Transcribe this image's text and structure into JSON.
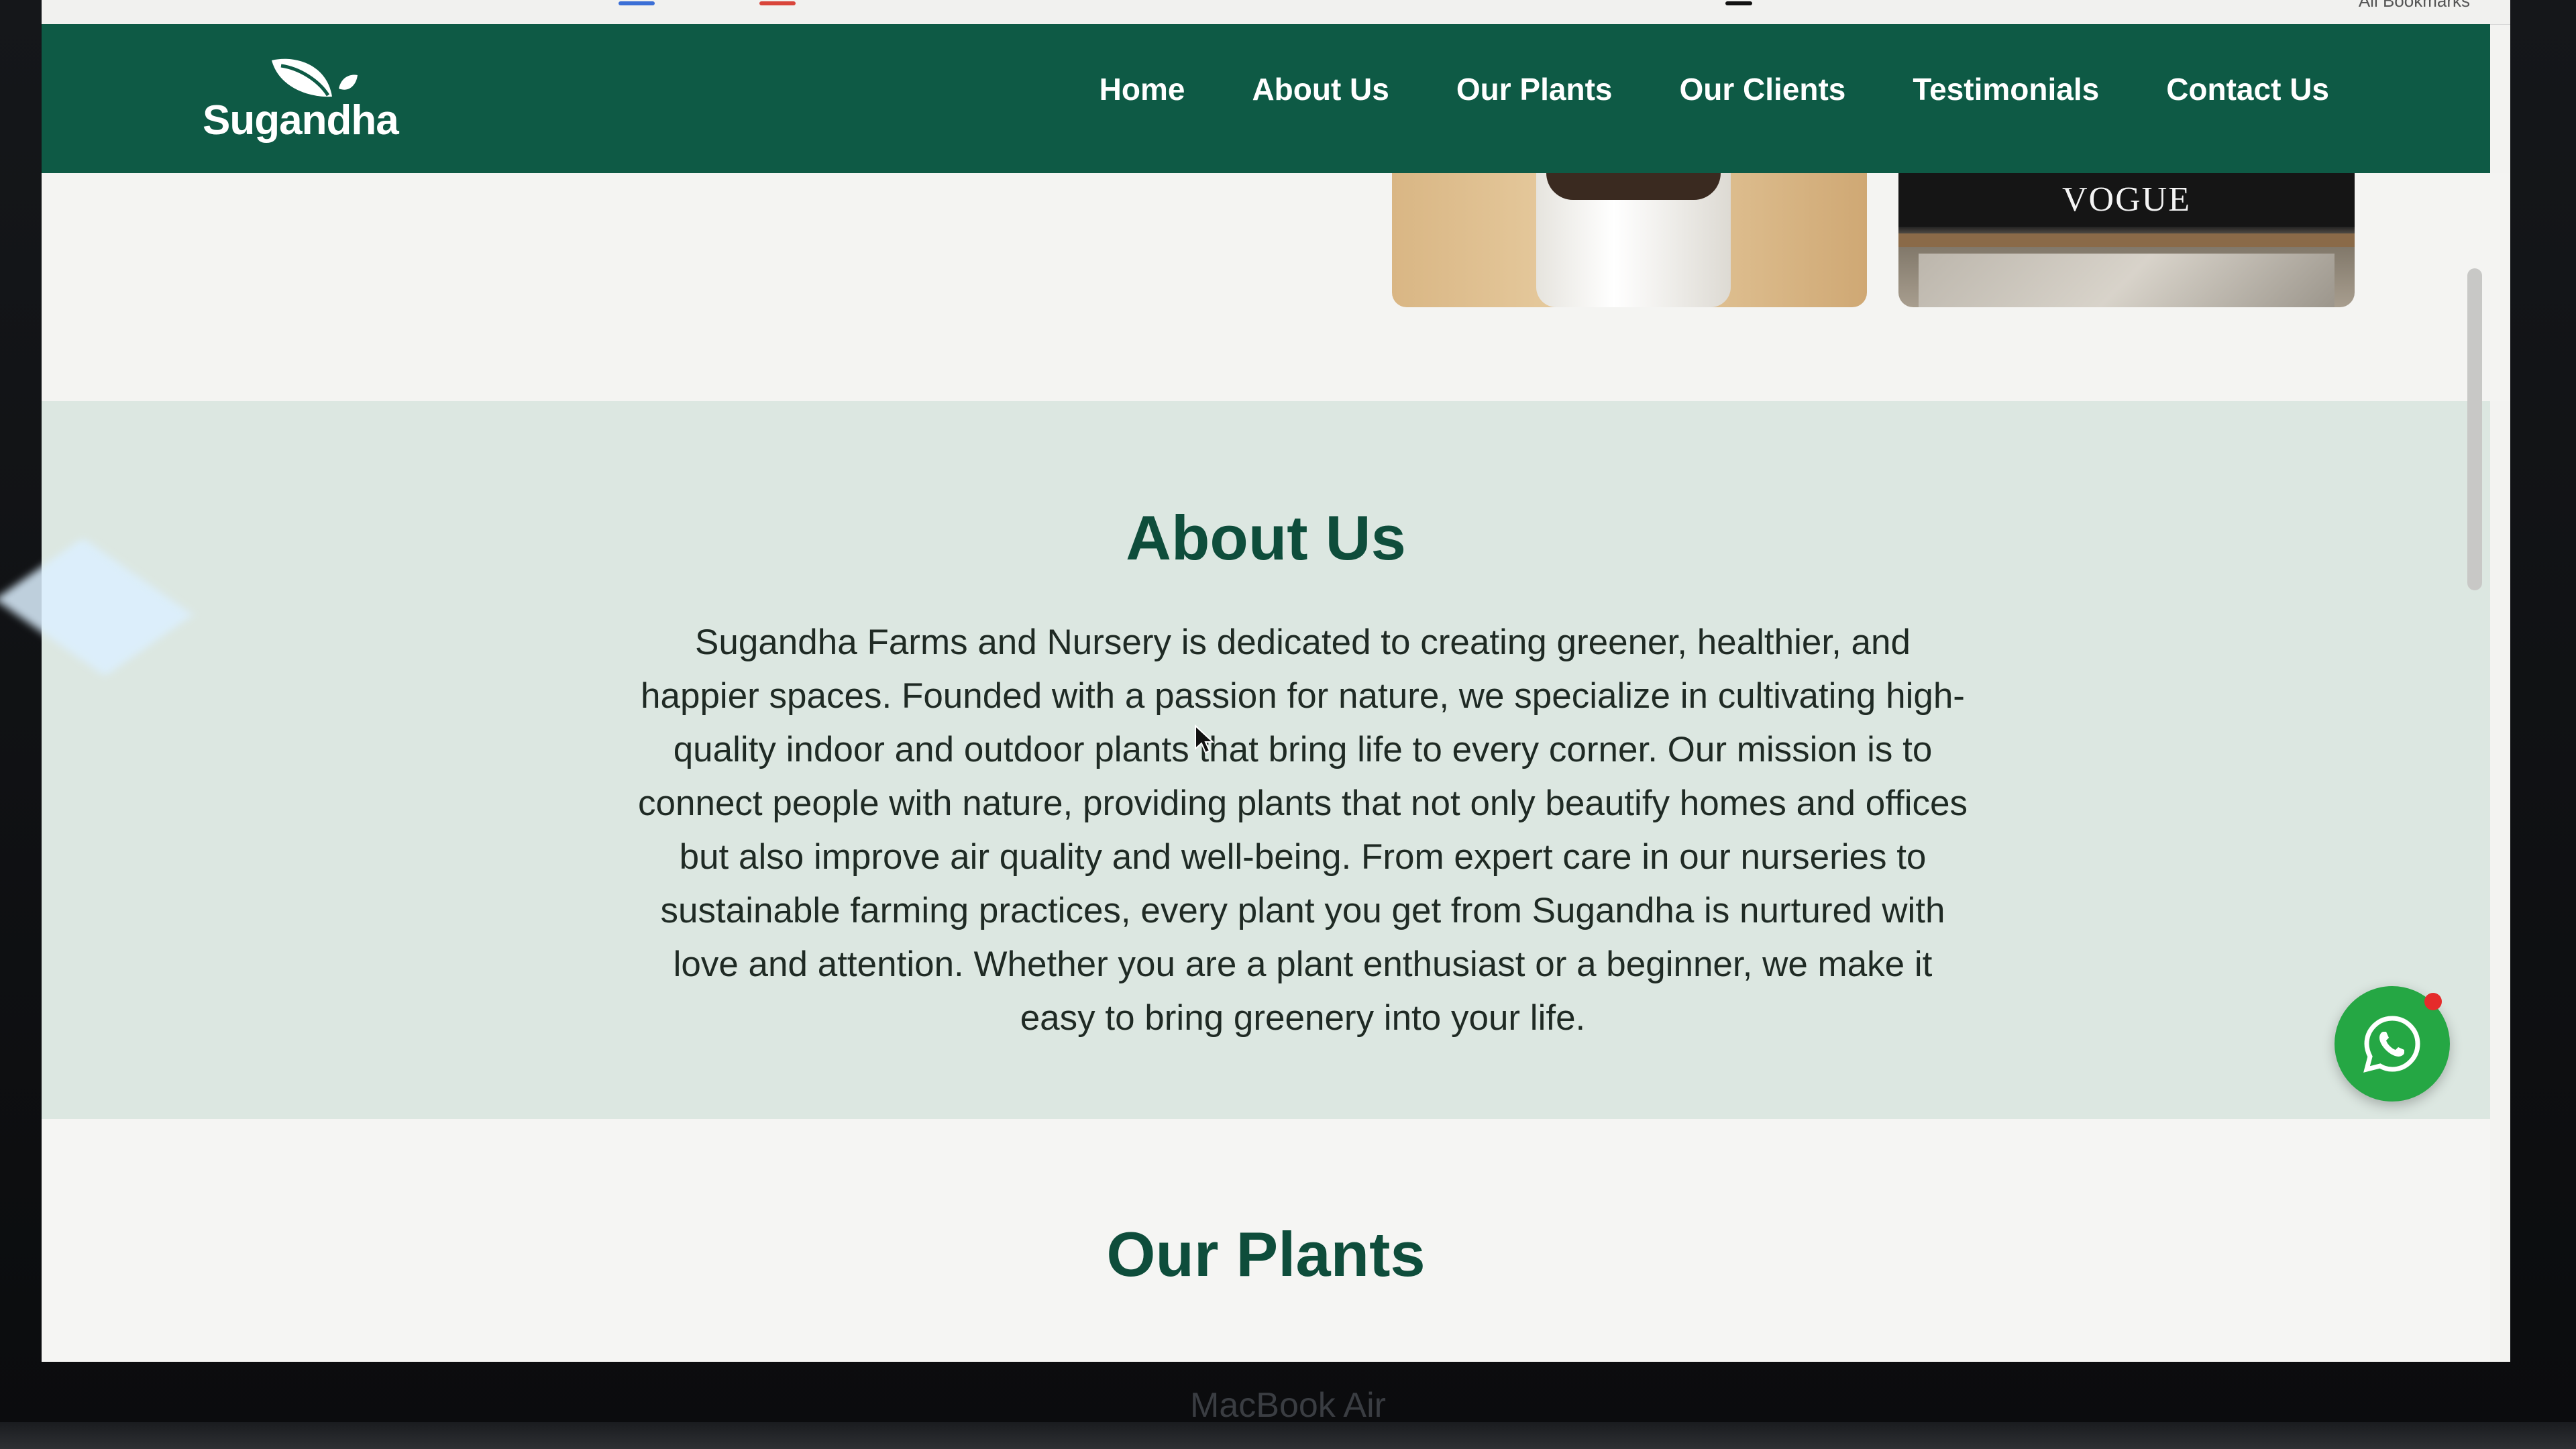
{
  "browser": {
    "bookmarks_label": "All Bookmarks"
  },
  "site": {
    "brand": "Sugandha",
    "brand_color": "#0e5a45",
    "nav": [
      {
        "label": "Home"
      },
      {
        "label": "About Us"
      },
      {
        "label": "Our Plants"
      },
      {
        "label": "Our Clients"
      },
      {
        "label": "Testimonials"
      },
      {
        "label": "Contact Us"
      }
    ]
  },
  "gallery": {
    "magazine_title": "VOGUE"
  },
  "about": {
    "title": "About Us",
    "body": "Sugandha Farms and Nursery is dedicated to creating greener, healthier, and happier spaces. Founded with a passion for nature, we specialize in cultivating high-quality indoor and outdoor plants that bring life to every corner. Our mission is to connect people with nature, providing plants that not only beautify homes and offices but also improve air quality and well-being. From expert care in our nurseries to sustainable farming practices, every plant you get from Sugandha is nurtured with love and attention. Whether you are a plant enthusiast or a beginner, we make it easy to bring greenery into your life."
  },
  "plants": {
    "title": "Our Plants"
  },
  "floating": {
    "whatsapp_icon": "whatsapp-icon",
    "whatsapp_color": "#25a744",
    "notification_color": "#e52b2b"
  },
  "device": {
    "label": "MacBook Air"
  }
}
